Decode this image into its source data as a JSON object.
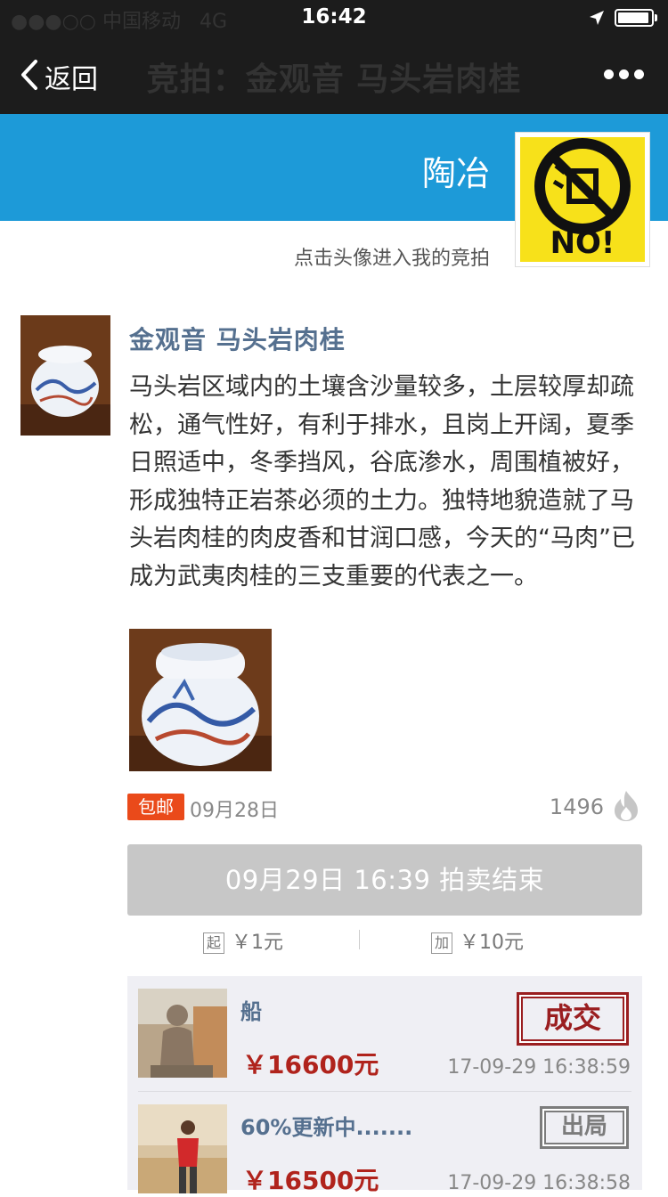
{
  "status_bar": {
    "carrier": "●●●○○ 中国移动",
    "network": "4G",
    "time": "16:42",
    "battery_level": 0.95
  },
  "nav": {
    "back_label": "返回",
    "title": "竞拍：金观音 马头岩肉桂"
  },
  "header": {
    "username": "陶冶",
    "avatar_hint": "点击头像进入我的竞拍",
    "avatar_text": "NO!"
  },
  "post": {
    "title": "金观音 马头岩肉桂",
    "body": "马头岩区域内的土壤含沙量较多，土层较厚却疏松，通气性好，有利于排水，且岗上开阔，夏季日照适中，冬季挡风，谷底渗水，周围植被好，形成独特正岩茶必须的土力。独特地貌造就了马头岩肉桂的肉皮香和甘润口感，今天的“马肉”已成为武夷肉桂的三支重要的代表之一。",
    "shipping_badge": "包邮",
    "date": "09月28日",
    "views": "1496"
  },
  "auction": {
    "status_text": "09月29日 16:39 拍卖结束",
    "start_badge": "起",
    "start_price": "￥1元",
    "increment_badge": "加",
    "increment_price": "￥10元"
  },
  "bids": [
    {
      "name": "船",
      "amount": "￥16600元",
      "time": "17-09-29 16:38:59",
      "stamp": "成交"
    },
    {
      "name": "60%更新中.......",
      "amount": "￥16500元",
      "time": "17-09-29 16:38:58",
      "stamp": "出局"
    }
  ],
  "colors": {
    "header_blue": "#1d9ad8",
    "dark_bar": "#1c1c1c",
    "title_blue": "#55708f",
    "price_red": "#b0231c",
    "badge_orange": "#ea4a1a"
  }
}
